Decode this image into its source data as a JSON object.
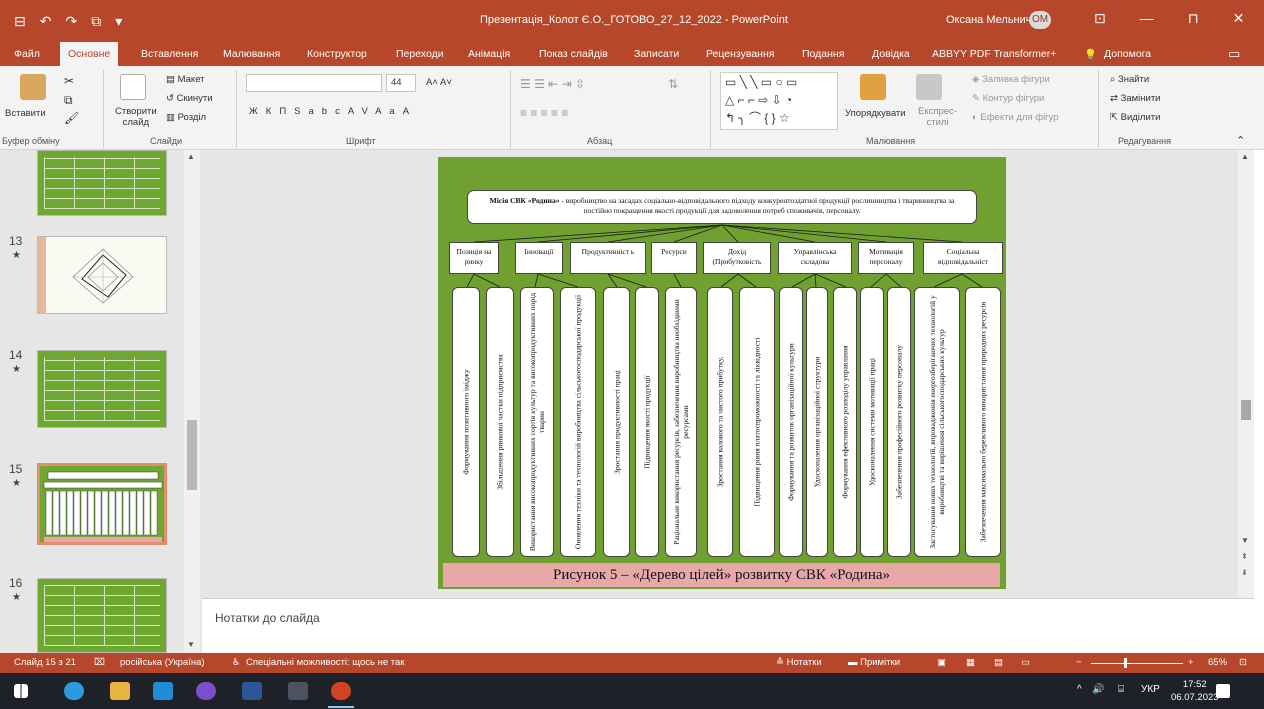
{
  "window": {
    "title": "Презентація_Колот Є.О._ГОТОВО_27_12_2022 - PowerPoint",
    "user_name": "Оксана Мельничук",
    "user_initials": "ОМ",
    "controls": {
      "ribbon_display": "⊡",
      "minimize": "—",
      "restore": "⊓",
      "close": "✕"
    }
  },
  "qat": {
    "save_icon": "⊟",
    "undo_icon": "↶",
    "redo_icon": "↷",
    "start_icon": "⧉",
    "customize_icon": "▾"
  },
  "tabs": [
    "Файл",
    "Основне",
    "Вставлення",
    "Малювання",
    "Конструктор",
    "Переходи",
    "Анімація",
    "Показ слайдів",
    "Записати",
    "Рецензування",
    "Подання",
    "Довідка",
    "ABBYY PDF Transformer+",
    "Допомога"
  ],
  "active_tab": "Основне",
  "ribbon": {
    "clipboard": {
      "paste": "Вставити",
      "label": "Буфер обміну"
    },
    "slides": {
      "new_slide_1": "Створити",
      "new_slide_2": "слайд",
      "layout": "Макет",
      "reset": "Скинути",
      "section": "Розділ",
      "label": "Слайди"
    },
    "font": {
      "size": "44",
      "label": "Шрифт",
      "bold": "Ж",
      "italic": "К",
      "underline": "П",
      "shadow": "S",
      "strike": "abc",
      "spacing": "AV",
      "case": "Aa",
      "color": "A"
    },
    "paragraph": {
      "label": "Абзац"
    },
    "drawing": {
      "arrange": "Упорядкувати",
      "quick_styles_1": "Експрес-",
      "quick_styles_2": "стилі",
      "fill": "Заливка фігури",
      "outline": "Контур фігури",
      "effects": "Ефекти для фігур",
      "label": "Малювання"
    },
    "editing": {
      "find": "Знайти",
      "replace": "Замінити",
      "select": "Виділити",
      "label": "Редагування"
    }
  },
  "thumbnails": [
    {
      "num": "13",
      "star": "★"
    },
    {
      "num": "14",
      "star": "★"
    },
    {
      "num": "15",
      "star": "★"
    },
    {
      "num": "16",
      "star": "★"
    }
  ],
  "slide": {
    "mission_bold": "Місія СВК «Родина»",
    "mission_text": " - виробництво на засадах соціально-відповідального підходу конкурентоздатної продукції рослинництва і тваринництва за постійно покращення якості продукції для задоволення потреб споживачів, персоналу.",
    "categories": [
      "Позиція на ринку",
      "Інновації",
      "Продуктивніст ь",
      "Ресурси",
      "Дохід (Прибутковість",
      "Управлінська складова",
      "Мотивація персоналу",
      "Соціальна відповідальніст"
    ],
    "goals": [
      "Формування позитивного іміджу",
      "Збільшення ринкової частки підприємства",
      "Використання високопродуктивних сортів культур та високопродуктивних порід тварин",
      "Оновлення техніки та технологій виробництва сільськогосподарської продукції",
      "Зростання продуктивності праці",
      "Підвищення якості продукції",
      "Раціональне використання ресурсів, забезпечення виробництва необхідними ресурсами",
      "Зростання валового та чистого прибутку,",
      "Підвищення рівня платоспроможності та ліквідності",
      "Формування та розвиток організаційної культури",
      "Удосконалення організаційної структури",
      "Формування ефективного розподілу управління",
      "Удосконалення системи мотивації праці",
      "Забезпечення професійного розвитку персоналу",
      "Застосування нових технологій, впровадження енергозберігаючих технологій у виробництві та вирішення сільськогосподарських культур",
      "Забезпечення максимально бережливого використання природних ресурсів"
    ],
    "caption": "Рисунок 5 – «Дерево цілей» розвитку СВК «Родина»"
  },
  "notes": {
    "placeholder": "Нотатки до слайда"
  },
  "status": {
    "slide_info": "Слайд 15 з 21",
    "language": "російська (Україна)",
    "accessibility": "Спеціальні можливості: щось не так",
    "notes_btn": "Нотатки",
    "comments_btn": "Примітки",
    "zoom_minus": "−",
    "zoom_plus": "+",
    "zoom": "65%"
  },
  "taskbar": {
    "language": "УКР",
    "time": "17:52",
    "date": "06.07.2023",
    "tray_up": "^",
    "volume": "🔊",
    "network": "⌸"
  },
  "colors": {
    "accent": "#b7472a",
    "slide_green": "#6fa030",
    "caption_pink": "#e8a8a8"
  }
}
